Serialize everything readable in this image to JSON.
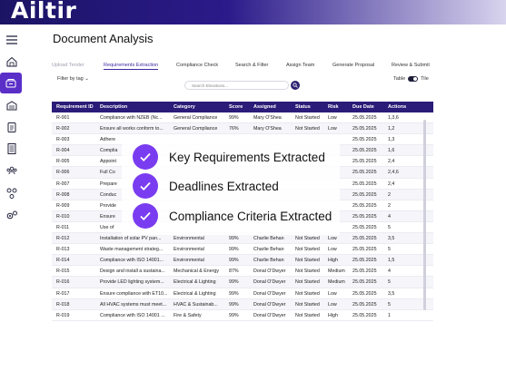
{
  "app": {
    "logo": "Ailtir"
  },
  "page": {
    "title": "Document Analysis"
  },
  "tabs": [
    {
      "label": "Upload Tender"
    },
    {
      "label": "Requirements Extraction"
    },
    {
      "label": "Compliance Check"
    },
    {
      "label": "Search & Filter"
    },
    {
      "label": "Assign Team"
    },
    {
      "label": "Generate Proposal"
    },
    {
      "label": "Review & Submit"
    }
  ],
  "toolbar": {
    "filter_label": "Filter by tag",
    "search_placeholder": "Search Elevations...",
    "view_table": "Table",
    "view_tile": "Tile"
  },
  "table": {
    "headers": [
      "Requirement ID",
      "Description",
      "Category",
      "Score",
      "Assigned",
      "Status",
      "Risk",
      "Due Date",
      "Actions"
    ],
    "rows": [
      [
        "R-001",
        "Compliance with NZEB (Nc...",
        "General Compliance",
        "99%",
        "Mary O'Shea",
        "Not Started",
        "Low",
        "25.05.2025",
        "1,3,6"
      ],
      [
        "R-002",
        "Ensure all works conform to...",
        "General Compliance",
        "76%",
        "Mary O'Shea",
        "Not Started",
        "Low",
        "25.05.2025",
        "1,2"
      ],
      [
        "R-003",
        "Adhere",
        "",
        "",
        "",
        "",
        "",
        "25.05.2025",
        "1,3"
      ],
      [
        "R-004",
        "Complia",
        "",
        "",
        "",
        "",
        "",
        "25.05.2025",
        "1,6"
      ],
      [
        "R-005",
        "Appoint",
        "",
        "",
        "",
        "",
        "",
        "25.05.2025",
        "2,4"
      ],
      [
        "R-006",
        "Full Co",
        "",
        "",
        "",
        "",
        "",
        "25.05.2025",
        "2,4,6"
      ],
      [
        "R-007",
        "Prepare",
        "",
        "",
        "",
        "",
        "",
        "25.05.2025",
        "2,4"
      ],
      [
        "R-008",
        "Conduc",
        "",
        "",
        "",
        "",
        "",
        "25.05.2025",
        "2"
      ],
      [
        "R-009",
        "Provide",
        "",
        "",
        "",
        "",
        "",
        "25.05.2025",
        "2"
      ],
      [
        "R-010",
        "Ensure",
        "",
        "",
        "",
        "",
        "",
        "25.05.2025",
        "4"
      ],
      [
        "R-011",
        "Use of",
        "",
        "",
        "",
        "",
        "",
        "25.05.2025",
        "5"
      ],
      [
        "R-012",
        "Installation of solar PV pan...",
        "Environmental",
        "99%",
        "Charlie Behan",
        "Not Started",
        "Low",
        "25.05.2025",
        "3,5"
      ],
      [
        "R-013",
        "Waste management strateg...",
        "Environmental",
        "99%",
        "Charlie Behan",
        "Not Started",
        "Low",
        "25.05.2025",
        "5"
      ],
      [
        "R-014",
        "Compliance with ISO 14001...",
        "Environmental",
        "99%",
        "Charlie Behan",
        "Not Started",
        "High",
        "25.05.2025",
        "1,5"
      ],
      [
        "R-015",
        "Design and install a sustaina...",
        "Mechanical & Energy",
        "87%",
        "Donal O'Dwyer",
        "Not Started",
        "Medium",
        "25.05.2025",
        "4"
      ],
      [
        "R-016",
        "Provide LED lighting system...",
        "Electrical & Lighting",
        "99%",
        "Donal O'Dwyer",
        "Not Started",
        "Medium",
        "25.05.2025",
        "5"
      ],
      [
        "R-017",
        "Ensure compliance with ET10...",
        "Electrical & Lighting",
        "99%",
        "Donal O'Dwyer",
        "Not Started",
        "Low",
        "25.05.2025",
        "3,5"
      ],
      [
        "R-018",
        "All HVAC systems must meet...",
        "HVAC & Sustainab...",
        "99%",
        "Donal O'Dwyer",
        "Not Started",
        "Low",
        "25.05.2025",
        "5"
      ],
      [
        "R-019",
        "Compliance with ISO 14001 ...",
        "Fire & Safety",
        "99%",
        "Donal O'Dwyer",
        "Not Started",
        "High",
        "25.05.2025",
        "1"
      ]
    ]
  },
  "overlay": {
    "features": [
      "Key Requirements Extracted",
      "Deadlines Extracted",
      "Compliance Criteria Extracted"
    ]
  },
  "colors": {
    "accent": "#7a3cf0",
    "header": "#2a1c78",
    "brand": "#1b1464"
  }
}
